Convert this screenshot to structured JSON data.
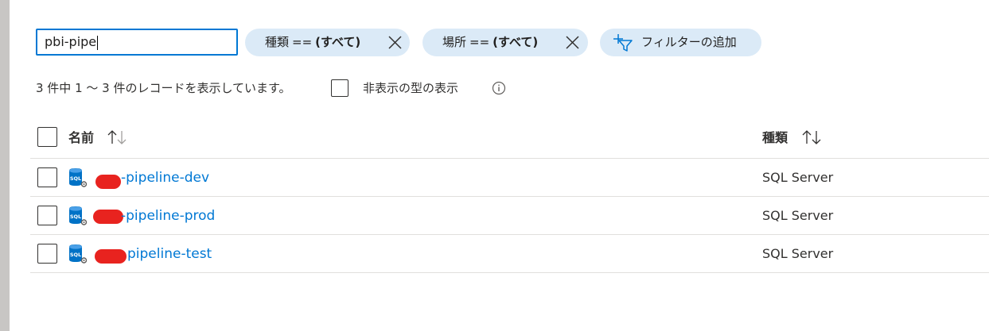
{
  "search": {
    "value": "pbi-pipe"
  },
  "filters": [
    {
      "key": "種類",
      "op": "==",
      "value": "(すべて)"
    },
    {
      "key": "場所",
      "op": "==",
      "value": "(すべて)"
    }
  ],
  "add_filter_label": "フィルターの追加",
  "status_text": "3 件中 1 ～ 3 件のレコードを表示しています。",
  "show_hidden_label": "非表示の型の表示",
  "columns": {
    "name": "名前",
    "type": "種類"
  },
  "rows": [
    {
      "name": "-pipeline-dev",
      "type": "SQL Server"
    },
    {
      "name": "-pipeline-prod",
      "type": "SQL Server"
    },
    {
      "name": "pipeline-test",
      "type": "SQL Server"
    }
  ],
  "icons": {
    "filter_remove": "close-icon",
    "add_filter": "filter-add-icon",
    "info": "info-icon",
    "sort": "sort-arrows-icon",
    "row": "sql-server-icon"
  },
  "colors": {
    "accent": "#0078d4",
    "pill_bg": "#dbeaf7",
    "redaction": "#e8231f"
  }
}
